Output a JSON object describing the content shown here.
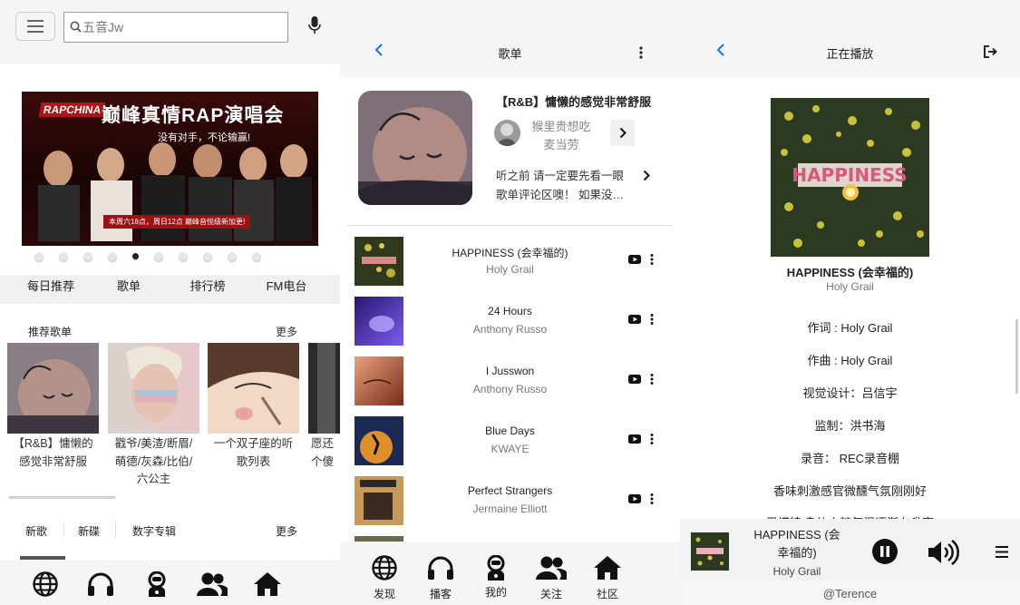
{
  "discover": {
    "search_placeholder": "五音Jw",
    "nav": [
      "每日推荐",
      "歌单",
      "排行榜",
      "FM电台"
    ],
    "rec_title": "推荐歌单",
    "more": "更多",
    "banner": {
      "badge": "RAPCHINA",
      "title": "巅峰真情RAP演唱会",
      "slogan": "没有对手，不论输赢!",
      "footer": "本周六18点，周日12点 巅峰音悦级新加更!"
    },
    "playlists": [
      {
        "name": "【R&B】慵懒的感觉非常舒服",
        "lines": [
          "【R&B】慵懒的",
          "感觉非常舒服"
        ]
      },
      {
        "name": "戳爷/美渣/断眉/萌德/灰森/比伯/六公主",
        "lines": [
          "戳爷/美渣/断眉/",
          "萌德/灰森/比伯/",
          "六公主"
        ]
      },
      {
        "name": "一个双子座的听歌列表",
        "lines": [
          "一个双子座的听",
          "歌列表"
        ]
      },
      {
        "name": "愿还…",
        "lines": [
          "愿还",
          "个傻"
        ]
      }
    ],
    "tabs2": [
      "新歌",
      "新碟",
      "数字专辑"
    ],
    "more2": "更多",
    "banner_dots": 10,
    "banner_active_dot": 5
  },
  "playlist": {
    "header_title": "歌单",
    "title": "【R&B】慵懒的感觉非常舒服",
    "user_line1": "猴里贵想吃",
    "user_line2": "麦当劳",
    "desc_line1": "听之前 请一定要先看一眼",
    "desc_line2": "歌单评论区噢！ 如果没…",
    "songs": [
      {
        "name": "HAPPINESS (会幸福的)",
        "artist": "Holy Grail"
      },
      {
        "name": "24 Hours",
        "artist": "Anthony Russo"
      },
      {
        "name": "I Jusswon",
        "artist": "Anthony Russo"
      },
      {
        "name": "Blue Days",
        "artist": "KWAYE"
      },
      {
        "name": "Perfect Strangers",
        "artist": "Jermaine Elliott"
      }
    ],
    "tabs": [
      "发现",
      "播客",
      "我的",
      "关注",
      "社区"
    ]
  },
  "now_playing": {
    "header_title": "正在播放",
    "cover_text": "HAPPINESS",
    "title": "HAPPINESS (会幸福的)",
    "artist": "Holy Grail",
    "lyrics": [
      "作词 : Holy Grail",
      "作曲 : Holy Grail",
      "视觉设计：吕信宇",
      "监制：洪书海",
      "录音： REC录音棚",
      "香味刺激感官微醺气氛刚刚好",
      "男模特 身体火辣气温逐渐在升高"
    ],
    "player_title_line1": "HAPPINESS (会",
    "player_title_line2": "幸福的)",
    "player_artist": "Holy Grail",
    "credit": "@Terence"
  },
  "colors": {
    "accent_blue": "#1a73e8",
    "panel_gray": "#f5f5f5"
  }
}
